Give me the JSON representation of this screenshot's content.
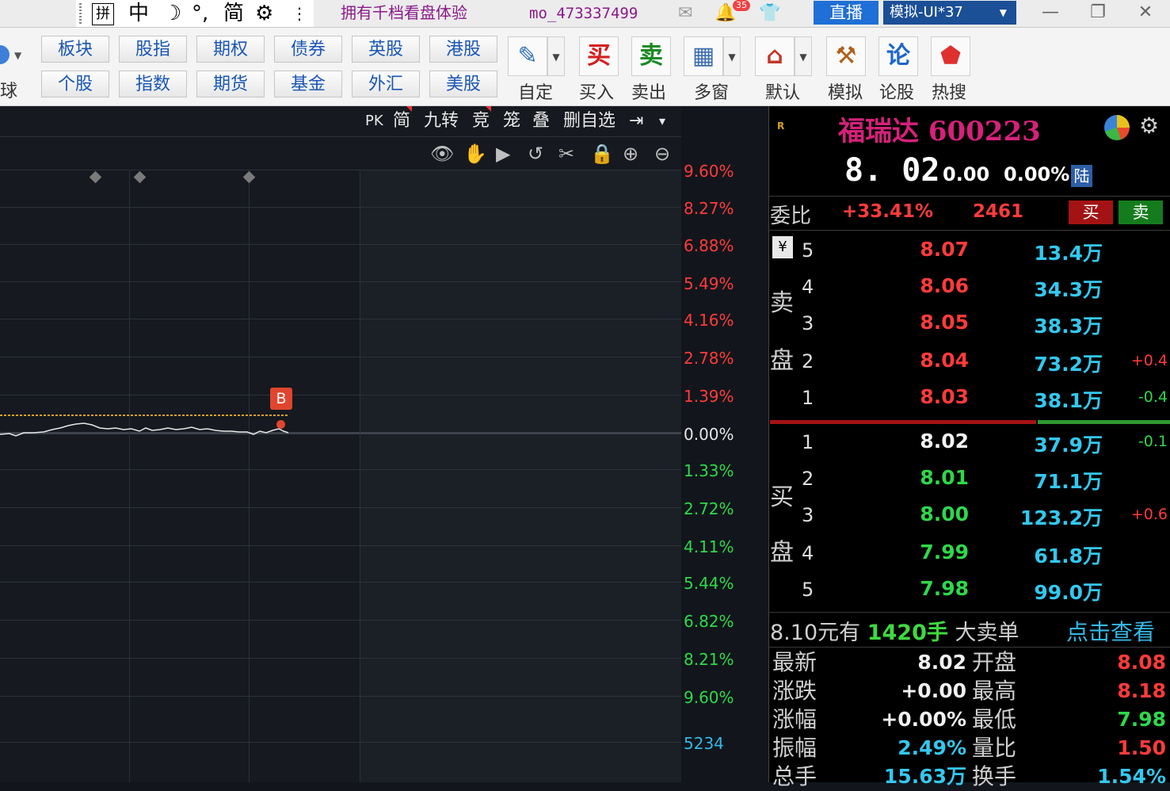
{
  "titlebar": {
    "ime": {
      "pin": "拼",
      "zh": "中",
      "moon": "☽",
      "punct": "°,",
      "trad": "简",
      "gear": "⚙",
      "ellipsis": "⋮"
    },
    "promo": "拥有千档看盘体验",
    "user_id": "mo_473337499",
    "message_count": "35",
    "live_label": "直播",
    "account_label": "模拟-UI*37",
    "min_icon": "minimize-icon",
    "max_icon": "restore-icon",
    "close_icon": "close-icon"
  },
  "toolbar": {
    "globe_label": "球",
    "markets_top": [
      "板块",
      "股指",
      "期权",
      "债券",
      "英股",
      "港股"
    ],
    "markets_bottom": [
      "个股",
      "指数",
      "期货",
      "基金",
      "外汇",
      "美股"
    ],
    "tools": [
      {
        "label": "自定",
        "glyph": "✎",
        "color": "#2f6fb7"
      },
      {
        "label": "买入",
        "glyph": "买",
        "color": "#d42020"
      },
      {
        "label": "卖出",
        "glyph": "卖",
        "color": "#1d8a25"
      },
      {
        "label": "多窗",
        "glyph": "▦",
        "color": "#3c6db0"
      },
      {
        "label": "默认",
        "glyph": "⌂",
        "color": "#c0392b"
      },
      {
        "label": "模拟",
        "glyph": "⚒",
        "color": "#b0601a"
      },
      {
        "label": "论股",
        "glyph": "论",
        "color": "#1e66c9"
      },
      {
        "label": "热搜",
        "glyph": "⬟",
        "color": "#e0302e"
      }
    ]
  },
  "chart": {
    "toolbar_items": [
      "PK",
      "简",
      "九转",
      "竞",
      "笼",
      "叠",
      "删自选",
      "⇥",
      "▾"
    ],
    "tool_icons": [
      "👁",
      "✋",
      "▶",
      "↺",
      "✂",
      "🔒",
      "⊕",
      "⊖"
    ],
    "marker_label": "B",
    "volume_axis_label": "5234",
    "axis_labels_up": [
      "9.60%",
      "8.27%",
      "6.88%",
      "5.49%",
      "4.16%",
      "2.78%",
      "1.39%"
    ],
    "axis_label_zero": "0.00%",
    "axis_labels_down": [
      "1.33%",
      "2.72%",
      "4.11%",
      "5.44%",
      "6.82%",
      "8.21%",
      "9.60%"
    ],
    "colors": {
      "up": "#ff3b3b",
      "down": "#2fd84a",
      "zero": "#e6e6e6",
      "volume": "#33b8e5"
    }
  },
  "quote": {
    "market_icon": "R",
    "name": "福瑞达 600223",
    "last_price": "8. 02",
    "change": "0.00",
    "change_pct": "0.00%",
    "market_badge": "陆",
    "weibi_label": "委比",
    "weibi_value": "+33.41%",
    "weicha_value": "2461",
    "buy_label": "买",
    "sell_label": "卖",
    "yen": "¥",
    "ask_side_chars": [
      "卖",
      "盘"
    ],
    "bid_side_chars": [
      "买",
      "盘"
    ],
    "asks": [
      {
        "level": "5",
        "price": "8.07",
        "volume": "13.4万",
        "delta": ""
      },
      {
        "level": "4",
        "price": "8.06",
        "volume": "34.3万",
        "delta": ""
      },
      {
        "level": "3",
        "price": "8.05",
        "volume": "38.3万",
        "delta": ""
      },
      {
        "level": "2",
        "price": "8.04",
        "volume": "73.2万",
        "delta": "+0.4"
      },
      {
        "level": "1",
        "price": "8.03",
        "volume": "38.1万",
        "delta": "-0.4"
      }
    ],
    "bids": [
      {
        "level": "1",
        "price": "8.02",
        "volume": "37.9万",
        "delta": "-0.1"
      },
      {
        "level": "2",
        "price": "8.01",
        "volume": "71.1万",
        "delta": ""
      },
      {
        "level": "3",
        "price": "8.00",
        "volume": "123.2万",
        "delta": "+0.6"
      },
      {
        "level": "4",
        "price": "7.99",
        "volume": "61.8万",
        "delta": ""
      },
      {
        "level": "5",
        "price": "7.98",
        "volume": "99.0万",
        "delta": ""
      }
    ],
    "big_order": {
      "price_text": "8.10元有",
      "qty": "1420手",
      "kind": "大卖单",
      "link": "点击查看"
    },
    "stats": [
      {
        "label": "最新",
        "value": "8.02",
        "label2": "开盘",
        "value2": "8.08"
      },
      {
        "label": "涨跌",
        "value": "+0.00",
        "label2": "最高",
        "value2": "8.18"
      },
      {
        "label": "涨幅",
        "value": "+0.00%",
        "label2": "最低",
        "value2": "7.98"
      },
      {
        "label": "振幅",
        "value": "2.49%",
        "label2": "量比",
        "value2": "1.50"
      },
      {
        "label": "总手",
        "value": "15.63万",
        "label2": "换手",
        "value2": "1.54%"
      }
    ]
  }
}
